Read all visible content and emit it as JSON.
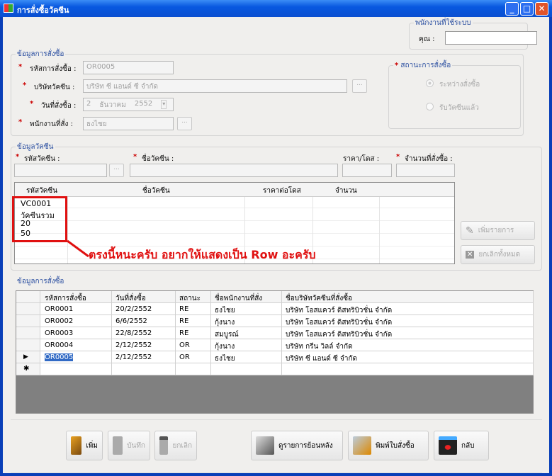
{
  "window": {
    "title": "การสั่งซื้อวัคซีน",
    "min": "_",
    "max": "□",
    "close": "✕"
  },
  "user_group": {
    "title": "พนักงานที่ใช้ระบบ",
    "label": "คุณ :",
    "value": ""
  },
  "order_group": {
    "title": "ข้อมูลการสั่งซื้อ",
    "req": "*",
    "order_id_label": "รหัสการสั่งซื้อ :",
    "order_id": "OR0005",
    "company_label": "บริษัทวัคซีน :",
    "company": "บริษัท ซี แอนด์ ซี จำกัด",
    "date_label": "วันที่สั่งซื้อ :",
    "date_day": "2",
    "date_month": "ธันวาคม",
    "date_year": "2552",
    "employee_label": "พนักงานที่สั่ง :",
    "employee": "ธงไชย",
    "browse": "..."
  },
  "status_group": {
    "title": "สถานะการสั่งซื้อ",
    "options": [
      {
        "label": "ระหว่างสั่งซื้อ",
        "checked": true
      },
      {
        "label": "รับวัคซีนแล้ว",
        "checked": false
      }
    ]
  },
  "vaccine_group": {
    "title": "ข้อมูลวัคซีน",
    "code_label": "รหัสวัคซีน :",
    "name_label": "ชื่อวัคซีน :",
    "price_label": "ราคา/โดส :",
    "qty_label": "จำนวนที่สั่งซื้อ :",
    "columns": [
      "รหัสวัคซีน",
      "ชื่อวัคซีน",
      "ราคาต่อโดส",
      "จำนวน"
    ],
    "stacked_values": [
      "VC0001",
      "วัคซีนรวม",
      "20",
      "50"
    ],
    "annotation": "ตรงนี้หนะครับ อยากให้แสดงเป็น Row อะครับ",
    "add_item": "เพิ่มรายการ",
    "cancel_all": "ยกเลิกทั้งหมด"
  },
  "orders_group": {
    "title": "ข้อมูลการสั่งซื้อ",
    "columns": [
      "รหัสการสั่งซื้อ",
      "วันที่สั่งซื้อ",
      "สถานะ",
      "ชื่อพนักงานที่สั่ง",
      "ชื่อบริษัทวัคซีนที่สั่งซื้อ"
    ],
    "rows": [
      [
        "OR0001",
        "20/2/2552",
        "RE",
        "ธงไชย",
        "บริษัท โอสแควร์ ดิสทริบิวชั่น จำกัด"
      ],
      [
        "OR0002",
        "6/6/2552",
        "RE",
        "กุ้งนาง",
        "บริษัท โอสแควร์ ดิสทริบิวชั่น จำกัด"
      ],
      [
        "OR0003",
        "22/8/2552",
        "RE",
        "สมบูรณ์",
        "บริษัท โอสแควร์ ดิสทริบิวชั่น จำกัด"
      ],
      [
        "OR0004",
        "2/12/2552",
        "OR",
        "กุ้งนาง",
        "บริษัท กรีน วิลล์ จำกัด"
      ],
      [
        "OR0005",
        "2/12/2552",
        "OR",
        "ธงไชย",
        "บริษัท ซี แอนด์ ซี จำกัด"
      ]
    ],
    "current_marker": "▶",
    "new_marker": "✱"
  },
  "toolbar": {
    "add": "เพิ่ม",
    "save": "บันทึก",
    "cancel": "ยกเลิก",
    "history": "ดูรายการย้อนหลัง",
    "print": "พิมพ์ใบสั่งซื้อ",
    "back": "กลับ"
  }
}
